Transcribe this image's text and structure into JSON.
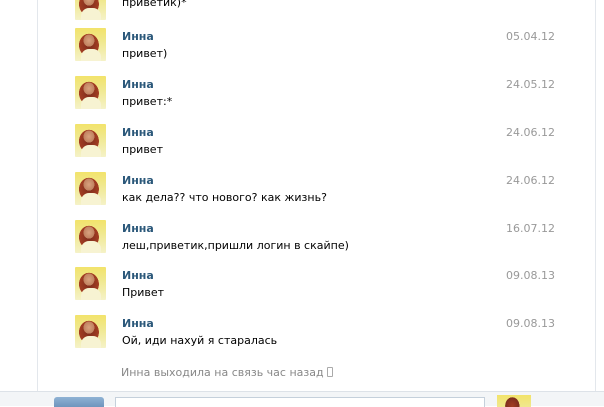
{
  "messages": [
    {
      "author": "",
      "date": "",
      "text": "приветик)*"
    },
    {
      "author": "Инна",
      "date": "05.04.12",
      "text": "привет)"
    },
    {
      "author": "Инна",
      "date": "24.05.12",
      "text": "привет:*"
    },
    {
      "author": "Инна",
      "date": "24.06.12",
      "text": "привет"
    },
    {
      "author": "Инна",
      "date": "24.06.12",
      "text": "как дела?? что нового? как жизнь?"
    },
    {
      "author": "Инна",
      "date": "16.07.12",
      "text": "леш,приветик,пришли логин в скайпе)"
    },
    {
      "author": "Инна",
      "date": "09.08.13",
      "text": "Привет"
    },
    {
      "author": "Инна",
      "date": "09.08.13",
      "text": "Ой, иди нахуй я старалась"
    }
  ],
  "status": {
    "last_seen": "Инна выходила на связь час назад",
    "device_icon": "mobile-phone-icon"
  },
  "colors": {
    "author": "#2b587a",
    "date": "#999999",
    "status": "#888888"
  }
}
